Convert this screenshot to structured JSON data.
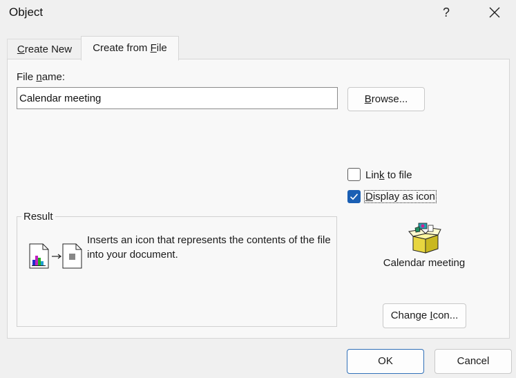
{
  "window": {
    "title": "Object",
    "help_label": "?"
  },
  "tabs": [
    {
      "label_pre": "",
      "label_key": "C",
      "label_post": "reate New",
      "active": false
    },
    {
      "label_pre": "Create from ",
      "label_key": "F",
      "label_post": "ile",
      "active": true
    }
  ],
  "file": {
    "label_pre": "File ",
    "label_key": "n",
    "label_post": "ame:",
    "value": "Calendar meeting"
  },
  "browse": {
    "label_pre": "",
    "label_key": "B",
    "label_post": "rowse..."
  },
  "link_to_file": {
    "label_pre": "Lin",
    "label_key": "k",
    "label_post": " to file",
    "checked": false
  },
  "display_as_icon": {
    "label_pre": "",
    "label_key": "D",
    "label_post": "isplay as icon",
    "checked": true
  },
  "result": {
    "legend": "Result",
    "description": "Inserts an icon that represents the contents of the file into your document."
  },
  "icon_preview": {
    "caption": "Calendar meeting",
    "icon": "package-icon"
  },
  "change_icon": {
    "label_pre": "Change ",
    "label_key": "I",
    "label_post": "con..."
  },
  "footer": {
    "ok_label": "OK",
    "cancel_label": "Cancel"
  },
  "colors": {
    "accent": "#1a5fb4",
    "dialog_bg": "#f0f0f0",
    "panel_bg": "#f8f8f8"
  }
}
